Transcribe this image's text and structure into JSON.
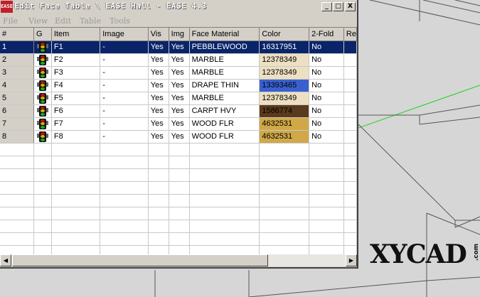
{
  "window": {
    "title": "Edit Face Table \\ EASE Hall - EASE 4.3",
    "app_icon_text": "EASE",
    "controls": {
      "minimize": "_",
      "maximize": "□",
      "close": "X"
    }
  },
  "menu": [
    "File",
    "View",
    "Edit",
    "Table",
    "Tools"
  ],
  "table": {
    "columns": [
      "#",
      "G",
      "Item",
      "Image",
      "Vis",
      "Img",
      "Face Material",
      "Color",
      "2-Fold",
      "Re"
    ],
    "rows": [
      {
        "num": "1",
        "item": "F1",
        "image": "-",
        "vis": "Yes",
        "img": "Yes",
        "material": "PEBBLEWOOD",
        "color": "16317951",
        "color_hex": "#0a246a",
        "fold": "No",
        "selected": true
      },
      {
        "num": "2",
        "item": "F2",
        "image": "-",
        "vis": "Yes",
        "img": "Yes",
        "material": "MARBLE",
        "color": "12378349",
        "color_hex": "#ede0c2",
        "fold": "No",
        "selected": false
      },
      {
        "num": "3",
        "item": "F3",
        "image": "-",
        "vis": "Yes",
        "img": "Yes",
        "material": "MARBLE",
        "color": "12378349",
        "color_hex": "#ede0c2",
        "fold": "No",
        "selected": false
      },
      {
        "num": "4",
        "item": "F4",
        "image": "-",
        "vis": "Yes",
        "img": "Yes",
        "material": "DRAPE THIN",
        "color": "13393465",
        "color_hex": "#3a60d0",
        "fold": "No",
        "selected": false
      },
      {
        "num": "5",
        "item": "F5",
        "image": "-",
        "vis": "Yes",
        "img": "Yes",
        "material": "MARBLE",
        "color": "12378349",
        "color_hex": "#ede0c2",
        "fold": "No",
        "selected": false
      },
      {
        "num": "6",
        "item": "F6",
        "image": "-",
        "vis": "Yes",
        "img": "Yes",
        "material": "CARPT HVY",
        "color": "1586774",
        "color_hex": "#5a3a1c",
        "fold": "No",
        "selected": false
      },
      {
        "num": "7",
        "item": "F7",
        "image": "-",
        "vis": "Yes",
        "img": "Yes",
        "material": "WOOD FLR",
        "color": "4632531",
        "color_hex": "#d0a848",
        "fold": "No",
        "selected": false
      },
      {
        "num": "8",
        "item": "F8",
        "image": "-",
        "vis": "Yes",
        "img": "Yes",
        "material": "WOOD FLR",
        "color": "4632531",
        "color_hex": "#d0a848",
        "fold": "No",
        "selected": false
      }
    ]
  },
  "watermark": {
    "text": "XYCAD",
    "suffix": ".com"
  }
}
